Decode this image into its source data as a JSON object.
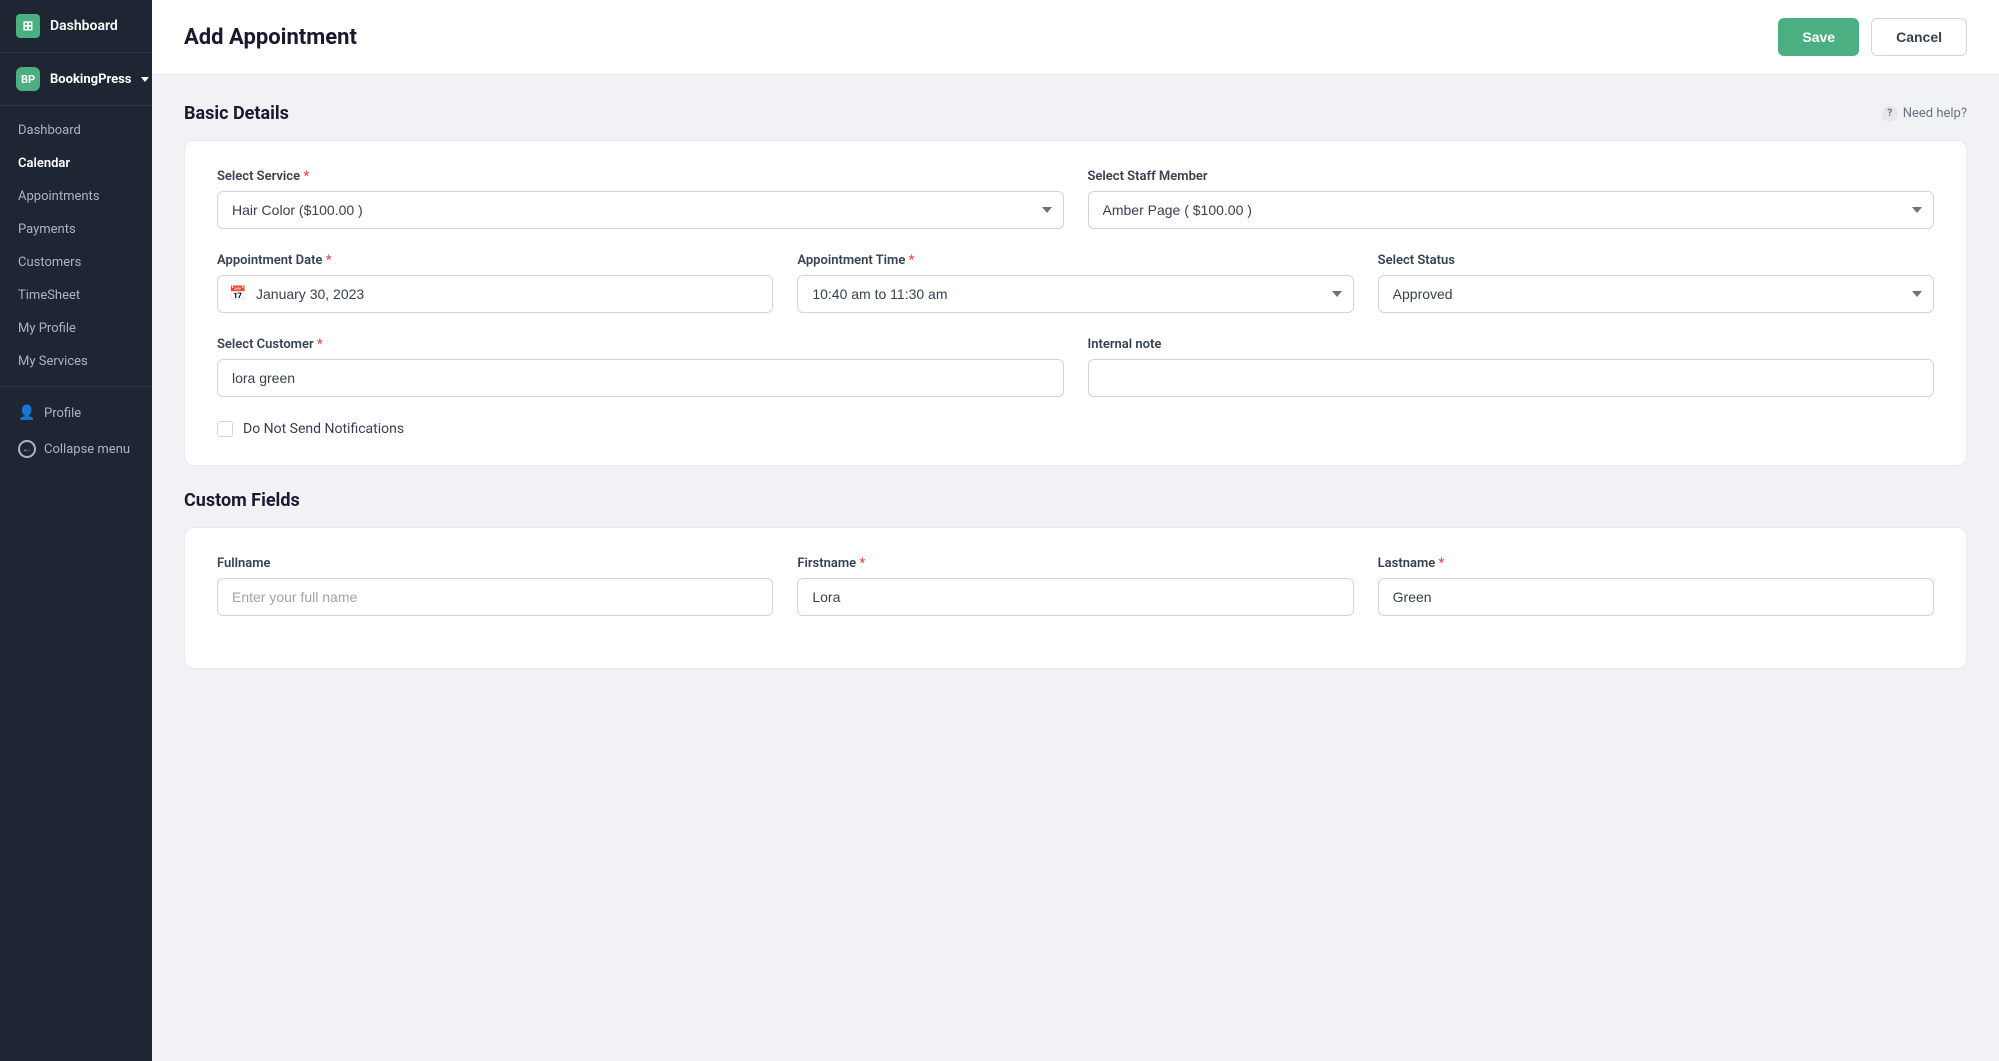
{
  "app": {
    "name": "Dashboard",
    "brand": "BookingPress"
  },
  "sidebar": {
    "items": [
      {
        "id": "dashboard",
        "label": "Dashboard",
        "active": false
      },
      {
        "id": "calendar",
        "label": "Calendar",
        "active": true
      },
      {
        "id": "appointments",
        "label": "Appointments",
        "active": false
      },
      {
        "id": "payments",
        "label": "Payments",
        "active": false
      },
      {
        "id": "customers",
        "label": "Customers",
        "active": false
      },
      {
        "id": "timesheet",
        "label": "TimeSheet",
        "active": false
      },
      {
        "id": "my-profile",
        "label": "My Profile",
        "active": false
      },
      {
        "id": "my-services",
        "label": "My Services",
        "active": false
      }
    ],
    "profile_label": "Profile",
    "collapse_label": "Collapse menu"
  },
  "header": {
    "title": "Add Appointment",
    "save_label": "Save",
    "cancel_label": "Cancel"
  },
  "basic_details": {
    "section_title": "Basic Details",
    "need_help_label": "Need help?",
    "select_service_label": "Select Service",
    "select_service_value": "Hair Color ($100.00 )",
    "select_staff_label": "Select Staff Member",
    "select_staff_value": "Amber Page ( $100.00 )",
    "appointment_date_label": "Appointment Date",
    "appointment_date_value": "January 30, 2023",
    "appointment_time_label": "Appointment Time",
    "appointment_time_value": "10:40 am to 11:30 am",
    "select_status_label": "Select Status",
    "select_status_value": "Approved",
    "select_customer_label": "Select Customer",
    "select_customer_value": "lora green",
    "internal_note_label": "Internal note",
    "internal_note_placeholder": "",
    "do_not_notify_label": "Do Not Send Notifications"
  },
  "custom_fields": {
    "section_title": "Custom Fields",
    "fullname_label": "Fullname",
    "fullname_placeholder": "Enter your full name",
    "firstname_label": "Firstname",
    "firstname_value": "Lora",
    "lastname_label": "Lastname",
    "lastname_value": "Green"
  },
  "colors": {
    "green": "#4caf82",
    "sidebar_bg": "#1e2533"
  }
}
